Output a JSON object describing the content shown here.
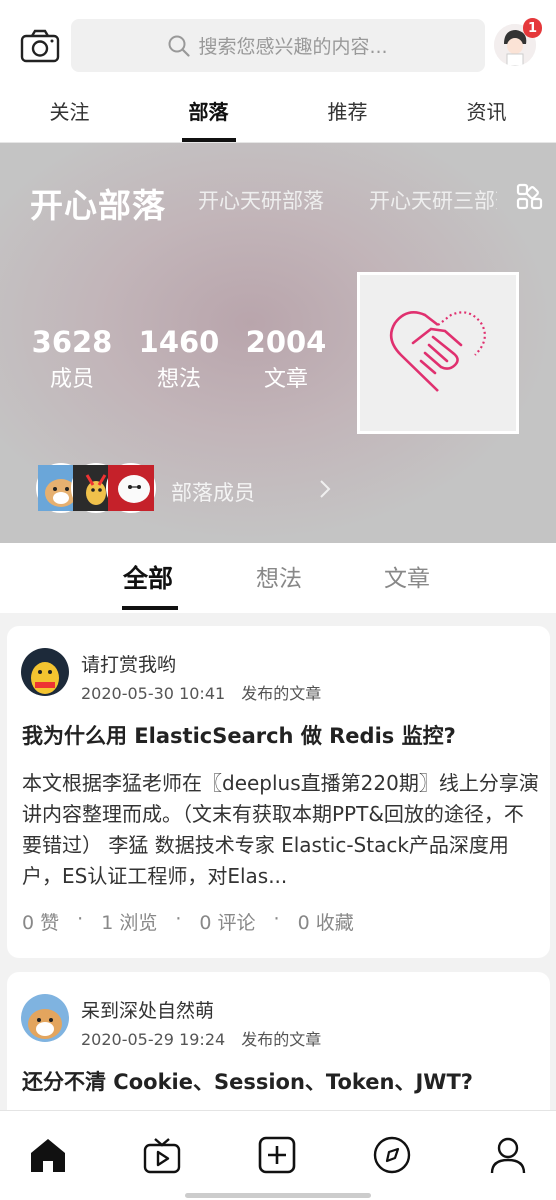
{
  "header": {
    "search_placeholder": "搜索您感兴趣的内容...",
    "notification_count": "1"
  },
  "tabs": [
    {
      "label": "关注"
    },
    {
      "label": "部落"
    },
    {
      "label": "推荐"
    },
    {
      "label": "资讯"
    }
  ],
  "banner": {
    "tribe_name": "开心部落",
    "other_tribes": [
      "开心天研部落",
      "开心天研三部落"
    ],
    "stats": [
      {
        "value": "3628",
        "label": "成员"
      },
      {
        "value": "1460",
        "label": "想法"
      },
      {
        "value": "2004",
        "label": "文章"
      }
    ],
    "members_label": "部落成员"
  },
  "sub_tabs": [
    {
      "label": "全部"
    },
    {
      "label": "想法"
    },
    {
      "label": "文章"
    }
  ],
  "posts": [
    {
      "author": "请打赏我哟",
      "time": "2020-05-30 10:41",
      "kind": "发布的文章",
      "title": "我为什么用 ElasticSearch 做 Redis 监控?",
      "body": "本文根据李猛老师在〖deeplus直播第220期〗线上分享演讲内容整理而成。（文末有获取本期PPT&回放的途径，不要错过） 李猛 数据技术专家 Elastic-Stack产品深度用户，ES认证工程师，对Elas...",
      "likes": "0 赞",
      "views": "1 浏览",
      "comments": "0 评论",
      "favorites": "0 收藏"
    },
    {
      "author": "呆到深处自然萌",
      "time": "2020-05-29 19:24",
      "kind": "发布的文章",
      "title": "还分不清 Cookie、Session、Token、JWT?"
    }
  ],
  "colors": {
    "accent": "#111111",
    "badge": "#e5383b",
    "logo_pink": "#e0306f",
    "banner_bg": "#c4c4c4"
  },
  "icons": {
    "camera": "camera-icon",
    "search": "search-icon",
    "grid": "grid-icon",
    "home": "home-icon",
    "video": "video-icon",
    "add": "add-icon",
    "discover": "compass-icon",
    "profile": "person-icon"
  }
}
